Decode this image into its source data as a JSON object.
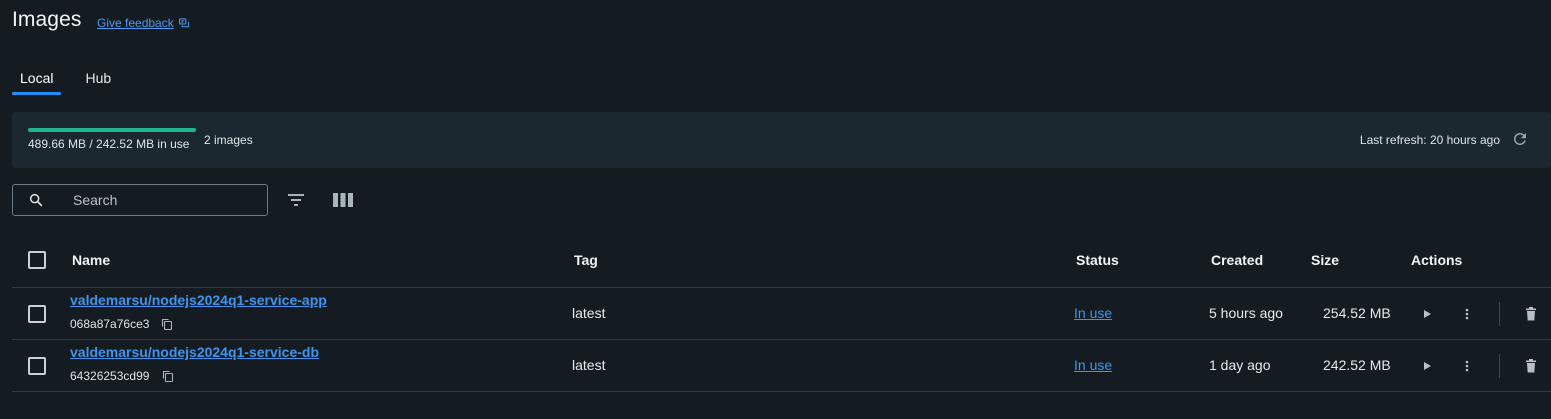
{
  "page": {
    "title": "Images",
    "feedback_label": "Give feedback"
  },
  "tabs": [
    {
      "label": "Local",
      "active": true
    },
    {
      "label": "Hub",
      "active": false
    }
  ],
  "usage": {
    "fill_fraction": 1.0,
    "text": "489.66 MB / 242.52 MB in use",
    "image_count": "2 images",
    "last_refresh": "Last refresh: 20 hours ago",
    "bar_color": "#1fb58c"
  },
  "toolbar": {
    "search_placeholder": "Search",
    "icons": [
      "search-icon",
      "filter-icon",
      "columns-icon"
    ]
  },
  "table": {
    "columns": [
      "Name",
      "Tag",
      "Status",
      "Created",
      "Size",
      "Actions"
    ],
    "rows": [
      {
        "name": "valdemarsu/nodejs2024q1-service-app",
        "id": "068a87a76ce3",
        "tag": "latest",
        "status": "In use",
        "created": "5 hours ago",
        "size": "254.52 MB"
      },
      {
        "name": "valdemarsu/nodejs2024q1-service-db",
        "id": "64326253cd99",
        "tag": "latest",
        "status": "In use",
        "created": "1 day ago",
        "size": "242.52 MB"
      }
    ],
    "action_icons": [
      "play-icon",
      "more-vertical-icon",
      "trash-icon"
    ]
  },
  "colors": {
    "background": "#141c22",
    "accent": "#1f8cf2",
    "link": "#3f95ee"
  }
}
